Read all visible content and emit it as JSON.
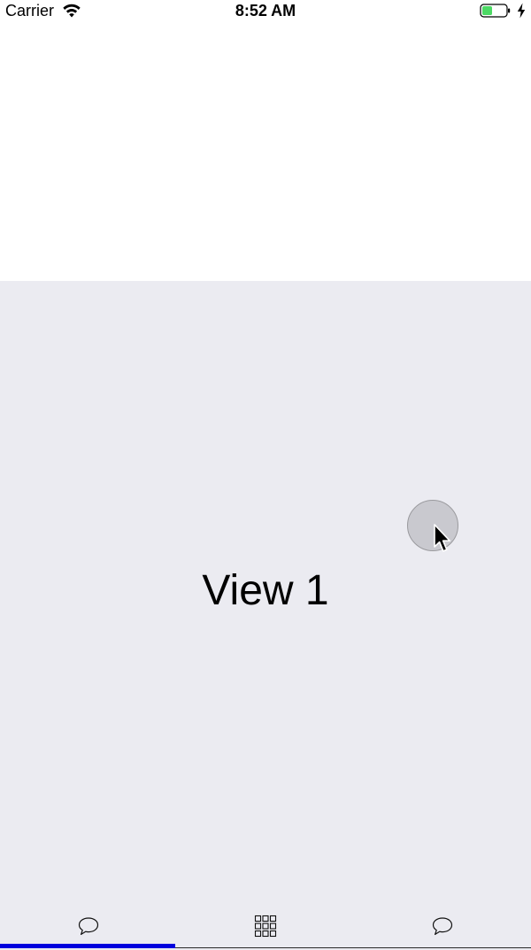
{
  "status_bar": {
    "carrier": "Carrier",
    "time": "8:52 AM",
    "wifi_icon": "wifi-icon",
    "battery_icon": "battery-icon",
    "battery_color": "#4cd964",
    "charging_icon": "charging-bolt-icon"
  },
  "content": {
    "title": "View 1",
    "background_color": "#ebebf1"
  },
  "tab_bar": {
    "tabs": [
      {
        "icon": "chat-bubble-icon",
        "selected": true
      },
      {
        "icon": "grid-icon",
        "selected": false
      },
      {
        "icon": "chat-bubble-icon",
        "selected": false
      }
    ],
    "indicator_color": "#0000dd"
  }
}
